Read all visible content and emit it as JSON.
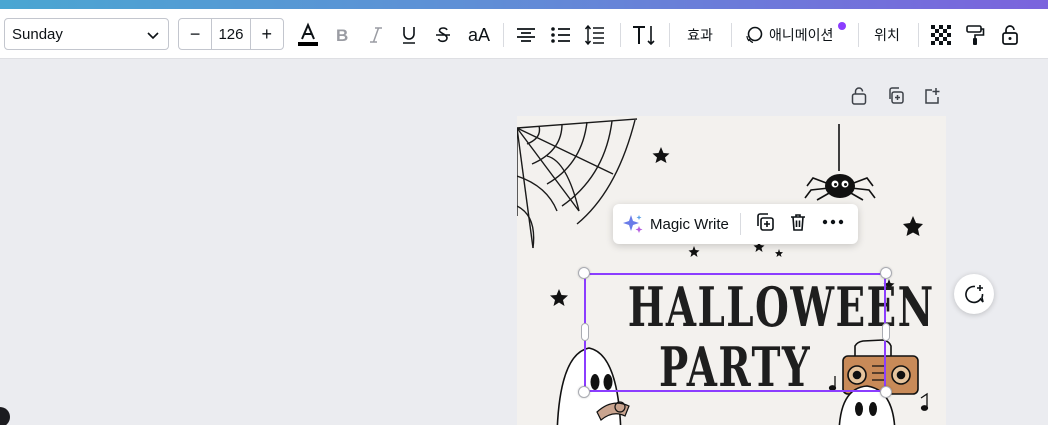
{
  "toolbar": {
    "font_name": "Sunday",
    "font_size": "126",
    "decrease_label": "−",
    "increase_label": "+",
    "case_label": "aA",
    "effects_label": "효과",
    "animate_label": "애니메이션",
    "position_label": "위치"
  },
  "context_menu": {
    "magic_write_label": "Magic Write"
  },
  "canvas": {
    "title_line1": "HALLOWEEN",
    "title_line2": "PARTY",
    "selection_color": "#8b3dff"
  },
  "colors": {
    "accent": "#8b3dff",
    "text_color_bar": "#000000"
  }
}
